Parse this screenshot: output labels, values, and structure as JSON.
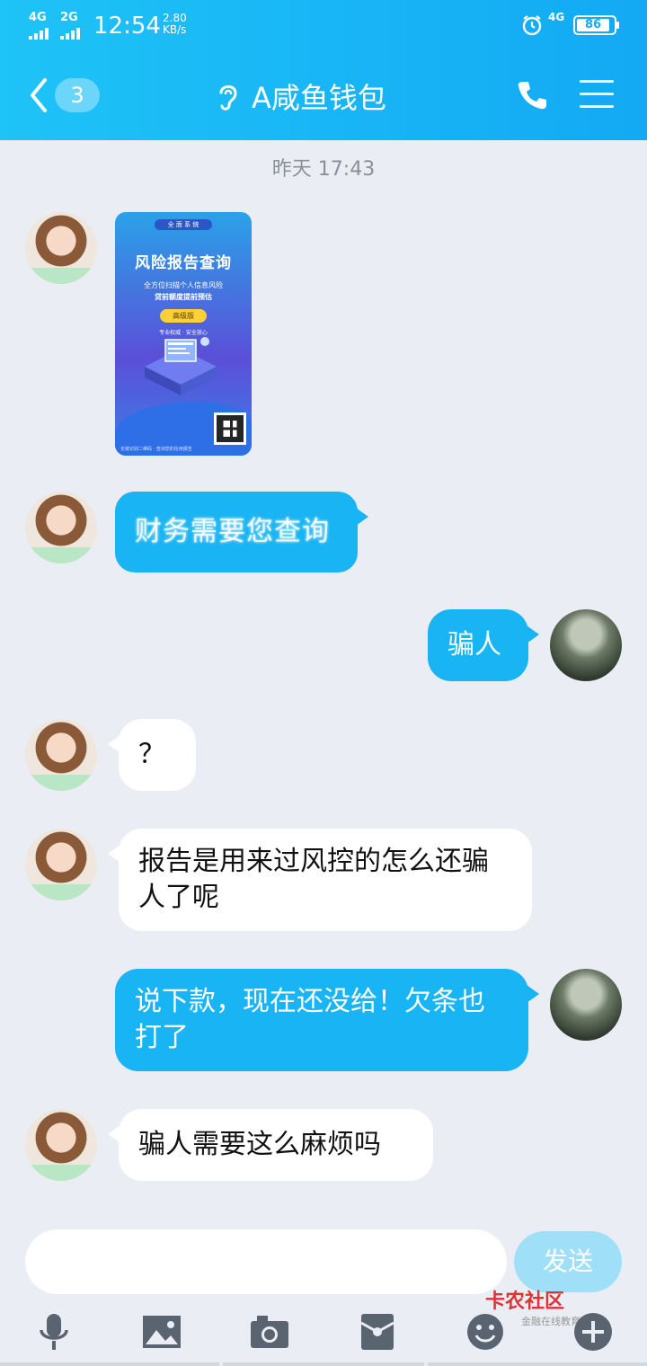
{
  "status": {
    "sig1": "4G",
    "sig2": "2G",
    "time": "12:54",
    "speed_value": "2.80",
    "speed_unit": "KB/s",
    "net": "4G",
    "battery": "86"
  },
  "header": {
    "unread": "3",
    "title": "A咸鱼钱包"
  },
  "chat": {
    "timestamp": "昨天 17:43",
    "poster": {
      "tag": "全 面 系 统",
      "title": "风险报告查询",
      "sub1": "全方位扫描个人信息风险",
      "sub2": "贷前额度提前预估",
      "button": "高级版",
      "note": "专业权威 · 安全放心",
      "foot": "长按识别二维码 · 查询您的信用报告"
    },
    "messages": [
      {
        "text": "财务需要您查询"
      },
      {
        "text": "骗人"
      },
      {
        "text": "？"
      },
      {
        "text": "报告是用来过风控的怎么还骗人了呢"
      },
      {
        "text": "说下款，现在还没给！欠条也打了"
      },
      {
        "text": "骗人需要这么麻烦吗"
      }
    ]
  },
  "input": {
    "placeholder": "",
    "send_label": "发送"
  },
  "watermark": {
    "brand": "卡农社区",
    "sub": "金融在线教育"
  },
  "icons": [
    "back-chevron-icon",
    "ear-icon",
    "phone-icon",
    "menu-icon",
    "mic-icon",
    "image-icon",
    "camera-icon",
    "red-packet-icon",
    "emoji-icon",
    "plus-icon"
  ],
  "colors": {
    "header": "#19a9f4",
    "bubble_out": "#19b4f3",
    "bubble_in": "#ffffff",
    "background": "#eaeef4"
  }
}
